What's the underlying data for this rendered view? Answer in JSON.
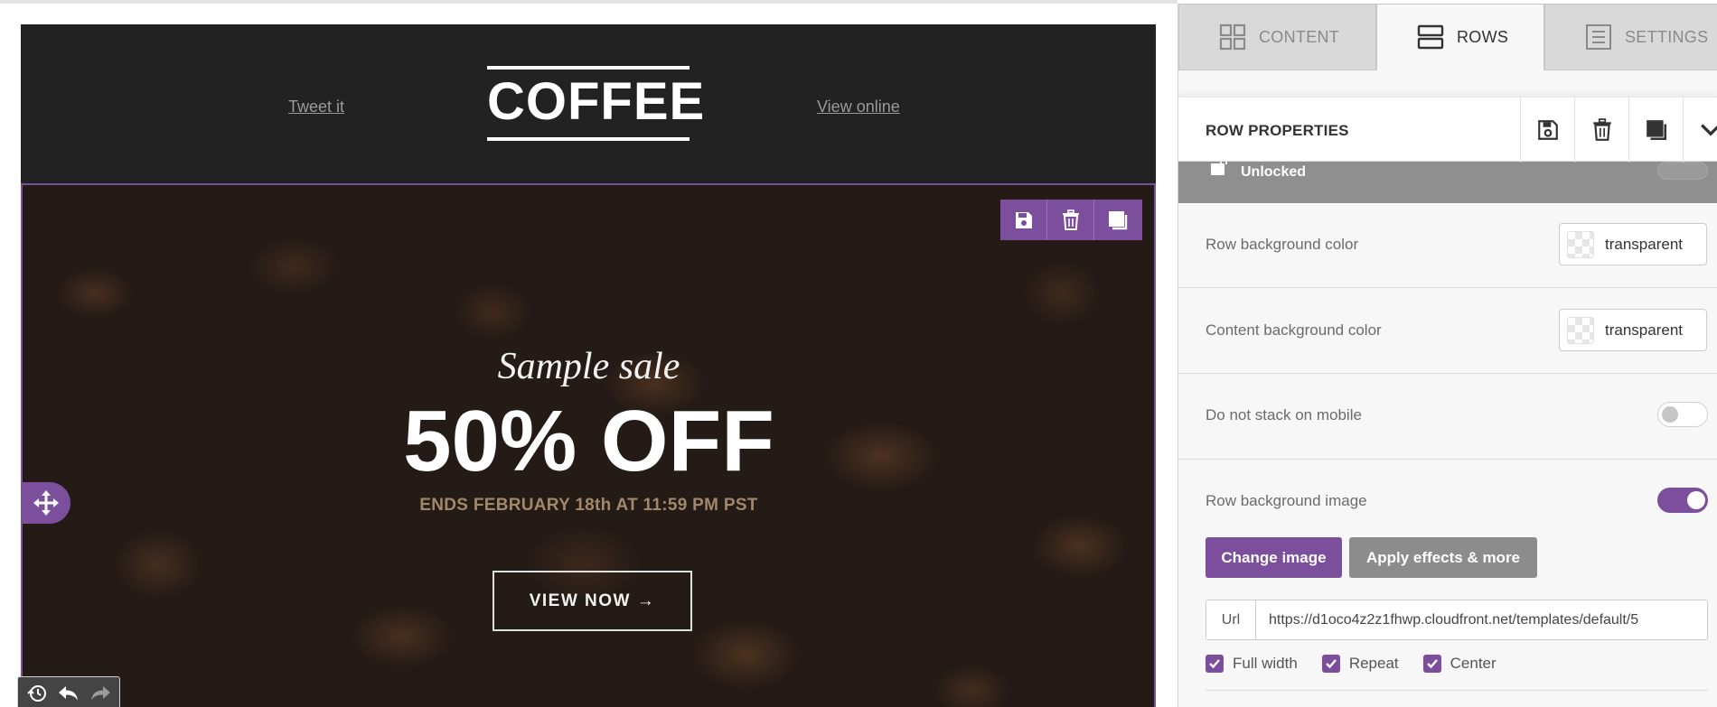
{
  "canvas": {
    "header": {
      "tweet_link": "Tweet it",
      "logo": "COFFEE",
      "online_link": "View online"
    },
    "hero": {
      "script_line": "Sample sale",
      "headline": "50% OFF",
      "ends_line": "ENDS FEBRUARY 18th AT 11:59 PM PST",
      "cta_label": "VIEW NOW →"
    },
    "row_toolbar": {
      "icons": [
        "save-icon",
        "trash-icon",
        "duplicate-icon"
      ]
    },
    "history_bar": {
      "icons": [
        "history-icon",
        "undo-icon",
        "redo-icon"
      ]
    }
  },
  "sidebar": {
    "tabs": [
      {
        "label": "CONTENT",
        "icon": "grid-icon",
        "active": false
      },
      {
        "label": "ROWS",
        "icon": "rows-icon",
        "active": true
      },
      {
        "label": "SETTINGS",
        "icon": "settings-list-icon",
        "active": false
      }
    ],
    "panel": {
      "title": "ROW PROPERTIES",
      "actions": [
        "save-icon",
        "trash-icon",
        "duplicate-icon",
        "chevron-down-icon"
      ],
      "unlocked_label": "Unlocked",
      "row_bg_label": "Row background color",
      "row_bg_value": "transparent",
      "content_bg_label": "Content background color",
      "content_bg_value": "transparent",
      "no_stack_label": "Do not stack on mobile",
      "no_stack_on": false,
      "bg_image_label": "Row background image",
      "bg_image_on": true,
      "change_image_label": "Change image",
      "apply_effects_label": "Apply effects & more",
      "url_label": "Url",
      "url_value": "https://d1oco4z2z1fhwp.cloudfront.net/templates/default/5",
      "options": [
        {
          "label": "Full width",
          "checked": true
        },
        {
          "label": "Repeat",
          "checked": true
        },
        {
          "label": "Center",
          "checked": true
        }
      ]
    }
  },
  "colors": {
    "accent": "#7b4f9b",
    "header_bg": "#222222",
    "ends_text": "#a1886b",
    "grey_button": "#8c8c8c"
  }
}
